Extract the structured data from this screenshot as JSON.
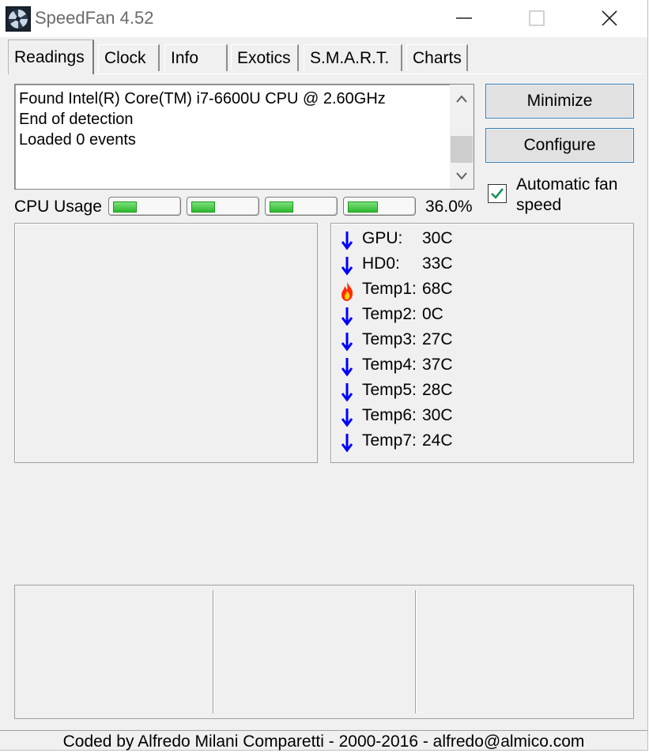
{
  "window": {
    "title": "SpeedFan 4.52"
  },
  "tabs": [
    {
      "label": "Readings"
    },
    {
      "label": "Clock"
    },
    {
      "label": "Info"
    },
    {
      "label": "Exotics"
    },
    {
      "label": "S.M.A.R.T."
    },
    {
      "label": "Charts"
    }
  ],
  "log": {
    "lines": [
      "Found Intel(R) Core(TM) i7-6600U CPU @ 2.60GHz",
      "End of detection",
      "Loaded 0 events"
    ]
  },
  "buttons": {
    "minimize": "Minimize",
    "configure": "Configure"
  },
  "auto_fan": {
    "label": "Automatic fan speed",
    "checked": true
  },
  "cpu": {
    "label": "CPU Usage",
    "percent_text": "36.0%",
    "core_fractions": [
      0.35,
      0.35,
      0.35,
      0.45
    ]
  },
  "temps": [
    {
      "name": "GPU:",
      "value": "30C",
      "icon": "down-arrow-icon"
    },
    {
      "name": "HD0:",
      "value": "33C",
      "icon": "down-arrow-icon"
    },
    {
      "name": "Temp1:",
      "value": "68C",
      "icon": "flame-icon"
    },
    {
      "name": "Temp2:",
      "value": "0C",
      "icon": "down-arrow-icon"
    },
    {
      "name": "Temp3:",
      "value": "27C",
      "icon": "down-arrow-icon"
    },
    {
      "name": "Temp4:",
      "value": "37C",
      "icon": "down-arrow-icon"
    },
    {
      "name": "Temp5:",
      "value": "28C",
      "icon": "down-arrow-icon"
    },
    {
      "name": "Temp6:",
      "value": "30C",
      "icon": "down-arrow-icon"
    },
    {
      "name": "Temp7:",
      "value": "24C",
      "icon": "down-arrow-icon"
    }
  ],
  "colors": {
    "arrow": "#0000ff",
    "flame_outer": "#ff2a00",
    "flame_inner": "#ffd200",
    "bar_fill": "#2fb82f"
  },
  "footer": {
    "text": "Coded by Alfredo Milani Comparetti - 2000-2016 - alfredo@almico.com"
  }
}
